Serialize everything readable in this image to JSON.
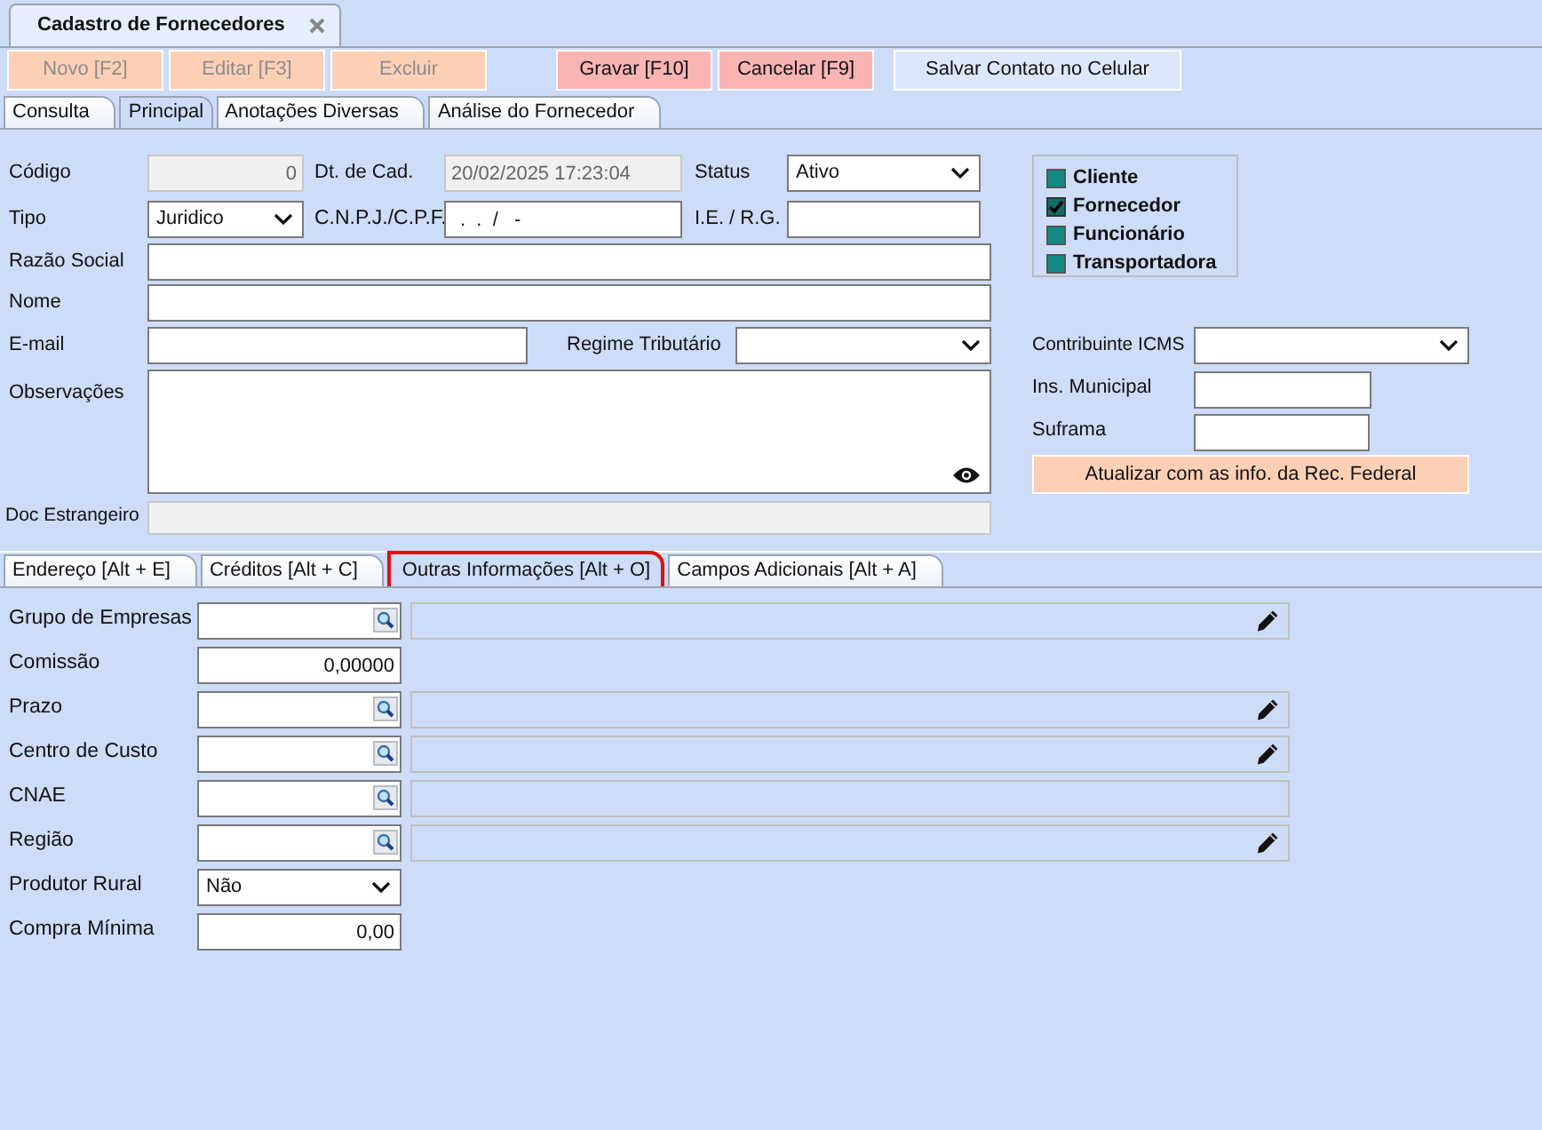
{
  "document_tabs": [
    {
      "label": "Cadastro de Fornecedores",
      "selected": true
    }
  ],
  "toolbar": [
    {
      "label": "Novo [F2]",
      "kind": "record",
      "disabled": true
    },
    {
      "label": "Editar [F3]",
      "kind": "record",
      "disabled": true
    },
    {
      "label": "Excluir",
      "kind": "record",
      "disabled": true
    },
    {
      "label": "Gravar [F10]",
      "kind": "commit",
      "disabled": false
    },
    {
      "label": "Cancelar [F9]",
      "kind": "commit",
      "disabled": false
    },
    {
      "label": "Salvar Contato no Celular",
      "kind": "plain",
      "disabled": false
    }
  ],
  "main_tabs": [
    {
      "label": "Consulta",
      "selected": false
    },
    {
      "label": "Principal",
      "selected": true
    },
    {
      "label": "Anotações Diversas",
      "selected": false
    },
    {
      "label": "Análise do Fornecedor",
      "selected": false
    }
  ],
  "principal": {
    "codigo": {
      "label": "Código",
      "value": "0",
      "disabled": true
    },
    "dt_cad": {
      "label": "Dt. de Cad.",
      "value": "20/02/2025 17:23:04",
      "disabled": true
    },
    "status": {
      "label": "Status",
      "value": "Ativo"
    },
    "tipo": {
      "label": "Tipo",
      "value": "Juridico"
    },
    "cnpj": {
      "label": "C.N.P.J./C.P.F.",
      "value": ".  .  /   -"
    },
    "ie_rg": {
      "label": "I.E. / R.G."
    },
    "razao_social": {
      "label": "Razão Social"
    },
    "nome": {
      "label": "Nome"
    },
    "email": {
      "label": "E-mail"
    },
    "regime": {
      "label": "Regime Tributário"
    },
    "observacoes": {
      "label": "Observações"
    },
    "doc_estrangeiro": {
      "label": "Doc Estrangeiro",
      "disabled": true
    }
  },
  "roles": [
    {
      "label": "Cliente",
      "checked": false
    },
    {
      "label": "Fornecedor",
      "checked": true
    },
    {
      "label": "Funcionário",
      "checked": false
    },
    {
      "label": "Transportadora",
      "checked": false
    }
  ],
  "fiscal": {
    "contribuinte_icms": {
      "label": "Contribuinte ICMS"
    },
    "ins_municipal": {
      "label": "Ins. Municipal"
    },
    "suframa": {
      "label": "Suframa"
    }
  },
  "update_button": "Atualizar com as info. da Rec. Federal",
  "lower_tabs": [
    {
      "label": "Endereço [Alt + E]",
      "selected": false
    },
    {
      "label": "Créditos [Alt + C]",
      "selected": false
    },
    {
      "label": "Outras Informações [Alt + O]",
      "selected": true
    },
    {
      "label": "Campos Adicionais [Alt + A]",
      "selected": false
    }
  ],
  "outras_informacoes": [
    {
      "label": "Grupo de Empresas",
      "kind": "lookup",
      "editable": true
    },
    {
      "label": "Comissão",
      "kind": "number",
      "value": "0,00000"
    },
    {
      "label": "Prazo",
      "kind": "lookup",
      "editable": true
    },
    {
      "label": "Centro de Custo",
      "kind": "lookup",
      "editable": true
    },
    {
      "label": "CNAE",
      "kind": "lookup",
      "editable": false
    },
    {
      "label": "Região",
      "kind": "lookup",
      "editable": true
    },
    {
      "label": "Produtor Rural",
      "kind": "select",
      "value": "Não"
    },
    {
      "label": "Compra Mínima",
      "kind": "number",
      "value": "0,00"
    }
  ]
}
